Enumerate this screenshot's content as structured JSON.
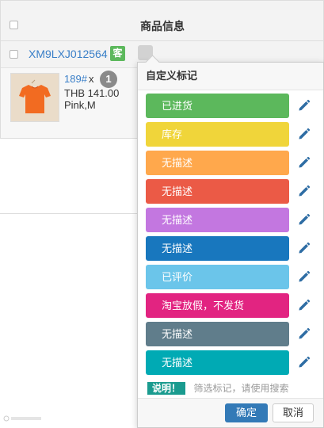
{
  "table": {
    "header_title": "商品信息",
    "order_id": "XM9LXJ012564",
    "order_badge": "客",
    "product": {
      "sku": "189#",
      "qty_x": "x",
      "qty": "1",
      "price": "THB 141.00",
      "variant": "Pink,M"
    }
  },
  "popover": {
    "title": "自定义标记",
    "tags": [
      {
        "label": "已进货",
        "color": "#5cb85c"
      },
      {
        "label": "库存",
        "color": "#f0d53a"
      },
      {
        "label": "无描述",
        "color": "#ffa84c"
      },
      {
        "label": "无描述",
        "color": "#eb5a46"
      },
      {
        "label": "无描述",
        "color": "#c377e0"
      },
      {
        "label": "无描述",
        "color": "#1877be"
      },
      {
        "label": "已评价",
        "color": "#6bc5ea"
      },
      {
        "label": "淘宝放假，不发货",
        "color": "#e22481"
      },
      {
        "label": "无描述",
        "color": "#607d8b"
      },
      {
        "label": "无描述",
        "color": "#00aab4"
      }
    ],
    "desc_badge": "说明！",
    "desc_text": "筛选标记，请使用搜索",
    "ok_label": "确定",
    "cancel_label": "取消"
  },
  "colors": {
    "accent": "#337ab7",
    "link": "#3a7fc8",
    "edit_icon": "#2e6da4"
  }
}
